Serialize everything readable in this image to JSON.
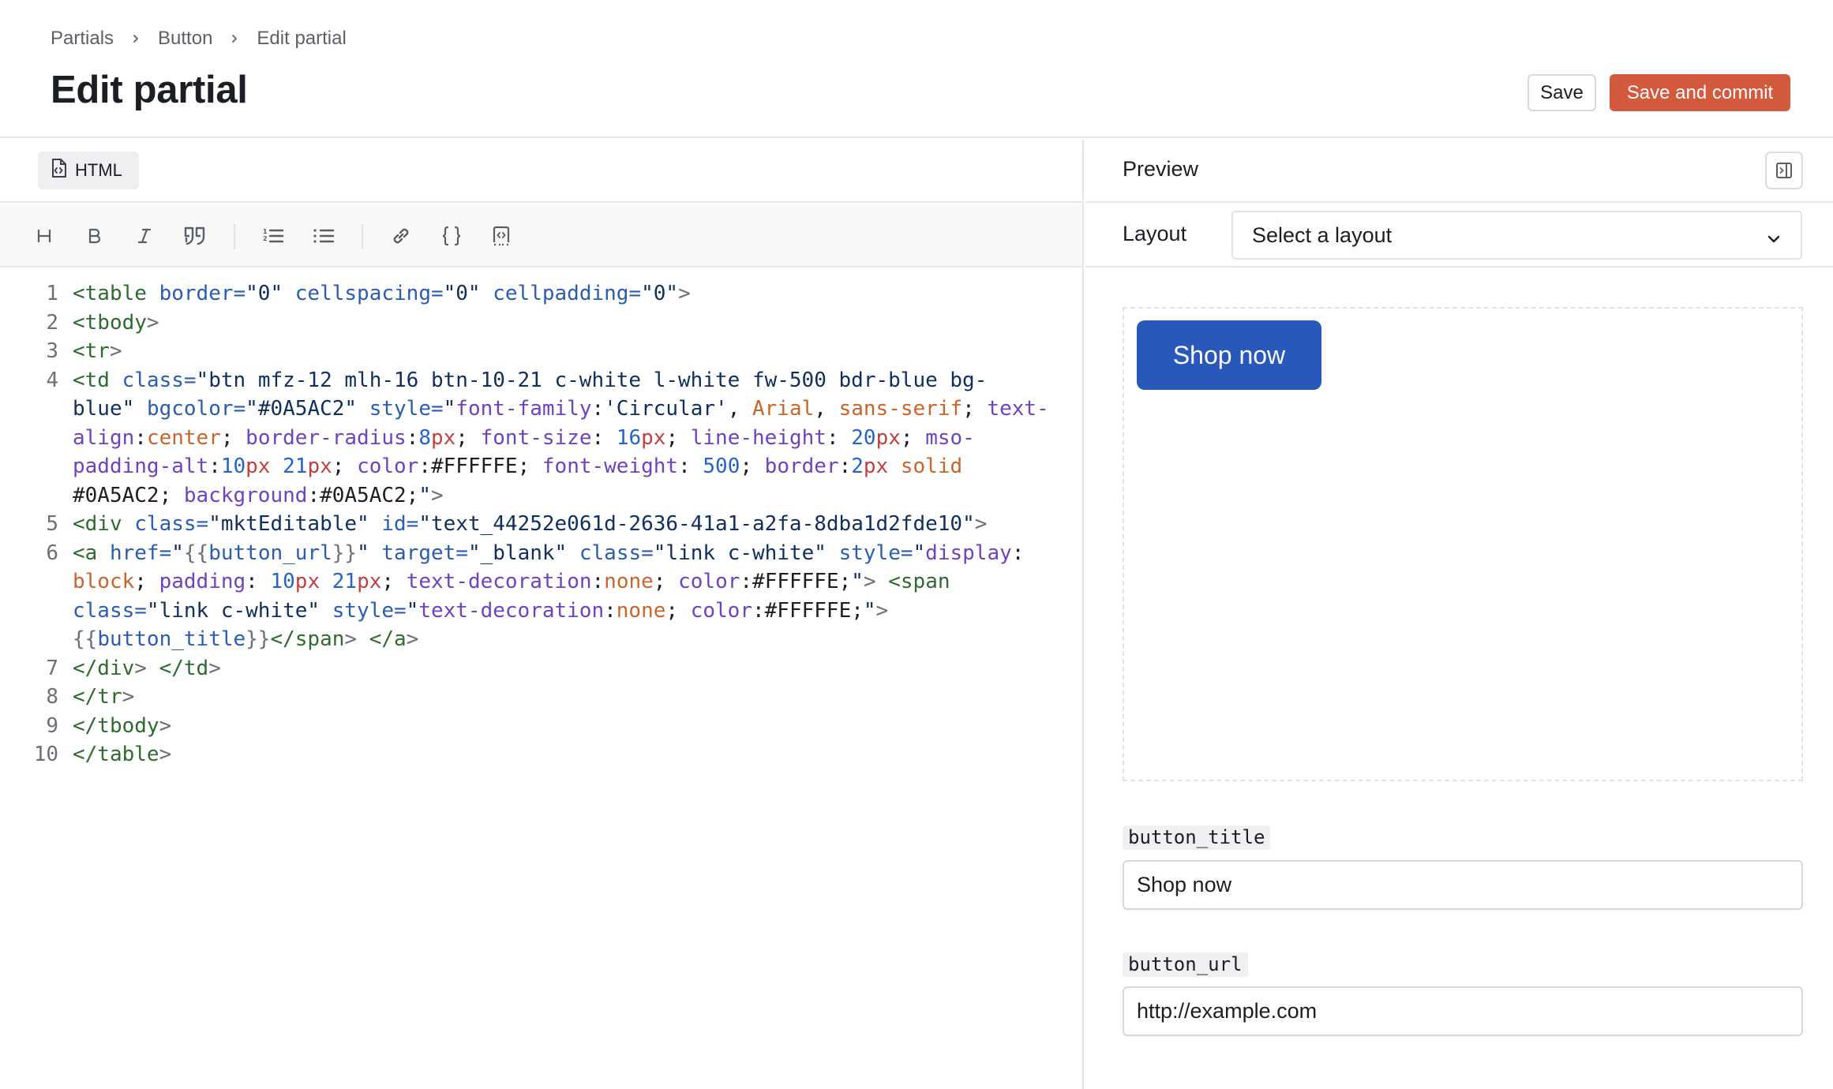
{
  "header": {
    "breadcrumb": [
      "Partials",
      "Button",
      "Edit partial"
    ],
    "title": "Edit partial",
    "save_label": "Save",
    "commit_label": "Save and commit"
  },
  "editor": {
    "tab_label": "HTML",
    "tab_icon": "file-code-icon",
    "toolbar": [
      {
        "name": "heading",
        "icon": "heading-icon"
      },
      {
        "name": "bold",
        "icon": "bold-icon"
      },
      {
        "name": "italic",
        "icon": "italic-icon"
      },
      {
        "name": "quote",
        "icon": "quote-icon"
      },
      {
        "name": "ordered-list",
        "icon": "ordered-list-icon"
      },
      {
        "name": "bullet-list",
        "icon": "bullet-list-icon"
      },
      {
        "name": "link",
        "icon": "link-icon"
      },
      {
        "name": "braces",
        "icon": "braces-icon"
      },
      {
        "name": "code-block",
        "icon": "code-block-icon"
      }
    ],
    "code_rows": [
      {
        "ln": "1",
        "tokens": [
          [
            "tag",
            "<table"
          ],
          [
            "plain",
            " "
          ],
          [
            "attr",
            "border="
          ],
          [
            "str",
            "\"0\""
          ],
          [
            "plain",
            " "
          ],
          [
            "attr",
            "cellspacing="
          ],
          [
            "str",
            "\"0\""
          ],
          [
            "plain",
            " "
          ],
          [
            "attr",
            "cellpadding="
          ],
          [
            "str",
            "\"0\""
          ],
          [
            "punct",
            ">"
          ]
        ]
      },
      {
        "ln": "2",
        "tokens": [
          [
            "tag",
            "<tbody"
          ],
          [
            "punct",
            ">"
          ]
        ]
      },
      {
        "ln": "3",
        "tokens": [
          [
            "tag",
            "<tr"
          ],
          [
            "punct",
            ">"
          ]
        ]
      },
      {
        "ln": "4",
        "tokens": [
          [
            "tag",
            "<td"
          ],
          [
            "plain",
            " "
          ],
          [
            "attr",
            "class="
          ],
          [
            "str",
            "\"btn mfz-12 mlh-16 btn-10-21 c-white l-white fw-500 bdr-blue bg-"
          ]
        ]
      },
      {
        "ln": "",
        "tokens": [
          [
            "str",
            "blue\""
          ],
          [
            "plain",
            " "
          ],
          [
            "attr",
            "bgcolor="
          ],
          [
            "str",
            "\"#0A5AC2\""
          ],
          [
            "plain",
            " "
          ],
          [
            "attr",
            "style="
          ],
          [
            "str",
            "\""
          ],
          [
            "prop",
            "font-family"
          ],
          [
            "plain",
            ":"
          ],
          [
            "str",
            "'Circular'"
          ],
          [
            "plain",
            ", "
          ],
          [
            "kw",
            "Arial"
          ],
          [
            "plain",
            ", "
          ],
          [
            "kw",
            "sans-serif"
          ],
          [
            "plain",
            "; "
          ],
          [
            "prop",
            "text-"
          ]
        ]
      },
      {
        "ln": "",
        "tokens": [
          [
            "prop",
            "align"
          ],
          [
            "plain",
            ":"
          ],
          [
            "kw",
            "center"
          ],
          [
            "plain",
            "; "
          ],
          [
            "prop",
            "border-radius"
          ],
          [
            "plain",
            ":"
          ],
          [
            "num",
            "8"
          ],
          [
            "unit",
            "px"
          ],
          [
            "plain",
            "; "
          ],
          [
            "prop",
            "font-size"
          ],
          [
            "plain",
            ": "
          ],
          [
            "num",
            "16"
          ],
          [
            "unit",
            "px"
          ],
          [
            "plain",
            "; "
          ],
          [
            "prop",
            "line-height"
          ],
          [
            "plain",
            ": "
          ],
          [
            "num",
            "20"
          ],
          [
            "unit",
            "px"
          ],
          [
            "plain",
            "; "
          ],
          [
            "prop",
            "mso-"
          ]
        ]
      },
      {
        "ln": "",
        "tokens": [
          [
            "prop",
            "padding-alt"
          ],
          [
            "plain",
            ":"
          ],
          [
            "num",
            "10"
          ],
          [
            "unit",
            "px"
          ],
          [
            "plain",
            " "
          ],
          [
            "num",
            "21"
          ],
          [
            "unit",
            "px"
          ],
          [
            "plain",
            "; "
          ],
          [
            "prop",
            "color"
          ],
          [
            "plain",
            ":#FFFFFE; "
          ],
          [
            "prop",
            "font-weight"
          ],
          [
            "plain",
            ": "
          ],
          [
            "num",
            "500"
          ],
          [
            "plain",
            "; "
          ],
          [
            "prop",
            "border"
          ],
          [
            "plain",
            ":"
          ],
          [
            "num",
            "2"
          ],
          [
            "unit",
            "px"
          ],
          [
            "plain",
            " "
          ],
          [
            "kw",
            "solid"
          ]
        ]
      },
      {
        "ln": "",
        "tokens": [
          [
            "plain",
            "#0A5AC2; "
          ],
          [
            "prop",
            "background"
          ],
          [
            "plain",
            ":#0A5AC2;"
          ],
          [
            "str",
            "\""
          ],
          [
            "punct",
            ">"
          ]
        ]
      },
      {
        "ln": "5",
        "tokens": [
          [
            "tag",
            "<div"
          ],
          [
            "plain",
            " "
          ],
          [
            "attr",
            "class="
          ],
          [
            "str",
            "\"mktEditable\""
          ],
          [
            "plain",
            " "
          ],
          [
            "attr",
            "id="
          ],
          [
            "str",
            "\"text_44252e061d-2636-41a1-a2fa-8dba1d2fde10\""
          ],
          [
            "punct",
            ">"
          ]
        ]
      },
      {
        "ln": "6",
        "tokens": [
          [
            "tag",
            "<a"
          ],
          [
            "plain",
            " "
          ],
          [
            "attr",
            "href="
          ],
          [
            "str",
            "\""
          ],
          [
            "punct",
            "{{"
          ],
          [
            "attr",
            "button_url"
          ],
          [
            "punct",
            "}}"
          ],
          [
            "str",
            "\""
          ],
          [
            "plain",
            " "
          ],
          [
            "attr",
            "target="
          ],
          [
            "str",
            "\"_blank\""
          ],
          [
            "plain",
            " "
          ],
          [
            "attr",
            "class="
          ],
          [
            "str",
            "\"link c-white\""
          ],
          [
            "plain",
            " "
          ],
          [
            "attr",
            "style="
          ],
          [
            "str",
            "\""
          ],
          [
            "prop",
            "display"
          ],
          [
            "plain",
            ":"
          ]
        ]
      },
      {
        "ln": "",
        "tokens": [
          [
            "kw",
            "block"
          ],
          [
            "plain",
            "; "
          ],
          [
            "prop",
            "padding"
          ],
          [
            "plain",
            ": "
          ],
          [
            "num",
            "10"
          ],
          [
            "unit",
            "px"
          ],
          [
            "plain",
            " "
          ],
          [
            "num",
            "21"
          ],
          [
            "unit",
            "px"
          ],
          [
            "plain",
            "; "
          ],
          [
            "prop",
            "text-decoration"
          ],
          [
            "plain",
            ":"
          ],
          [
            "kw",
            "none"
          ],
          [
            "plain",
            "; "
          ],
          [
            "prop",
            "color"
          ],
          [
            "plain",
            ":#FFFFFE;"
          ],
          [
            "str",
            "\""
          ],
          [
            "punct",
            "> "
          ],
          [
            "tag",
            "<span"
          ]
        ]
      },
      {
        "ln": "",
        "tokens": [
          [
            "attr",
            "class="
          ],
          [
            "str",
            "\"link c-white\""
          ],
          [
            "plain",
            " "
          ],
          [
            "attr",
            "style="
          ],
          [
            "str",
            "\""
          ],
          [
            "prop",
            "text-decoration"
          ],
          [
            "plain",
            ":"
          ],
          [
            "kw",
            "none"
          ],
          [
            "plain",
            "; "
          ],
          [
            "prop",
            "color"
          ],
          [
            "plain",
            ":#FFFFFE;"
          ],
          [
            "str",
            "\""
          ],
          [
            "punct",
            ">"
          ]
        ]
      },
      {
        "ln": "",
        "tokens": [
          [
            "punct",
            "{{"
          ],
          [
            "attr",
            "button_title"
          ],
          [
            "punct",
            "}}"
          ],
          [
            "tag",
            "</span"
          ],
          [
            "punct",
            "> "
          ],
          [
            "tag",
            "</a"
          ],
          [
            "punct",
            ">"
          ]
        ]
      },
      {
        "ln": "7",
        "tokens": [
          [
            "tag",
            "</div"
          ],
          [
            "punct",
            "> "
          ],
          [
            "tag",
            "</td"
          ],
          [
            "punct",
            ">"
          ]
        ]
      },
      {
        "ln": "8",
        "tokens": [
          [
            "tag",
            "</tr"
          ],
          [
            "punct",
            ">"
          ]
        ]
      },
      {
        "ln": "9",
        "tokens": [
          [
            "tag",
            "</tbody"
          ],
          [
            "punct",
            ">"
          ]
        ]
      },
      {
        "ln": "10",
        "tokens": [
          [
            "tag",
            "</table"
          ],
          [
            "punct",
            ">"
          ]
        ]
      }
    ]
  },
  "preview": {
    "title": "Preview",
    "toggle_icon": "panel-collapse-icon",
    "layout_label": "Layout",
    "layout_selected": "Select a layout",
    "rendered_button": {
      "label": "Shop now",
      "color": "#2859BA"
    },
    "fields": [
      {
        "name": "button_title",
        "value": "Shop now"
      },
      {
        "name": "button_url",
        "value": "http://example.com"
      }
    ]
  },
  "colors": {
    "accent": "#D35A3D",
    "preview_button": "#2859BA"
  }
}
